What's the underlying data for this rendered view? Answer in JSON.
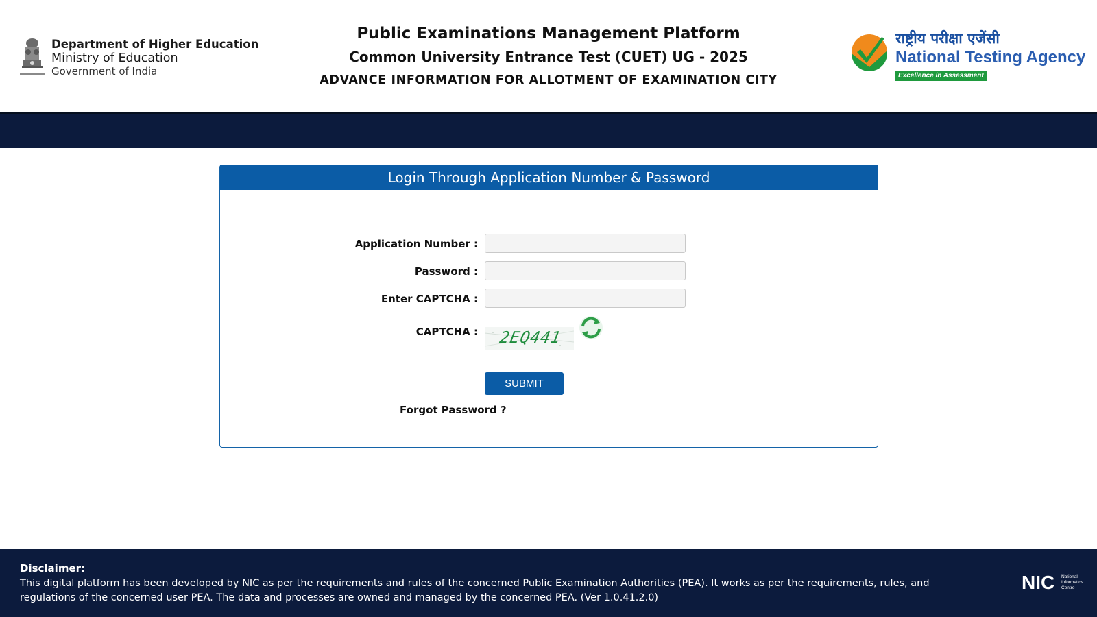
{
  "header": {
    "dept_line1": "Department of Higher Education",
    "dept_line2": "Ministry of Education",
    "dept_line3": "Government of India",
    "emblem_icon": "national-emblem-icon",
    "title": "Public Examinations Management Platform",
    "subtitle": "Common University Entrance Test (CUET) UG - 2025",
    "notice": "ADVANCE INFORMATION FOR ALLOTMENT OF EXAMINATION CITY",
    "nta_hindi": "राष्ट्रीय परीक्षा एजेंसी",
    "nta_name": "National Testing Agency",
    "nta_tagline": "Excellence in Assessment",
    "nta_icon": "nta-checkmark-logo-icon"
  },
  "login": {
    "heading": "Login Through Application Number & Password",
    "application_number_label": "Application Number :",
    "application_number_value": "",
    "password_label": "Password :",
    "password_value": "",
    "enter_captcha_label": "Enter CAPTCHA :",
    "enter_captcha_value": "",
    "captcha_label": "CAPTCHA :",
    "captcha_code": "2EQ441",
    "refresh_icon": "refresh-icon",
    "submit_label": "SUBMIT",
    "forgot_label": "Forgot Password ?"
  },
  "footer": {
    "disclaimer_title": "Disclaimer:",
    "disclaimer_text": "This digital platform has been developed by NIC as per the requirements and rules of the concerned Public Examination Authorities (PEA). It works as per the requirements, rules, and regulations of the concerned user PEA. The data and processes are owned and managed by the concerned PEA. (Ver 1.0.41.2.0)",
    "nic_logo": "NIC",
    "nic_logo_caption": "National Informatics Centre"
  },
  "colors": {
    "navy": "#0c1b3d",
    "panel_blue": "#0b5ca6",
    "nta_orange": "#f08a1c",
    "nta_green": "#1f9a3e",
    "captcha_green": "#1e8c3c"
  }
}
